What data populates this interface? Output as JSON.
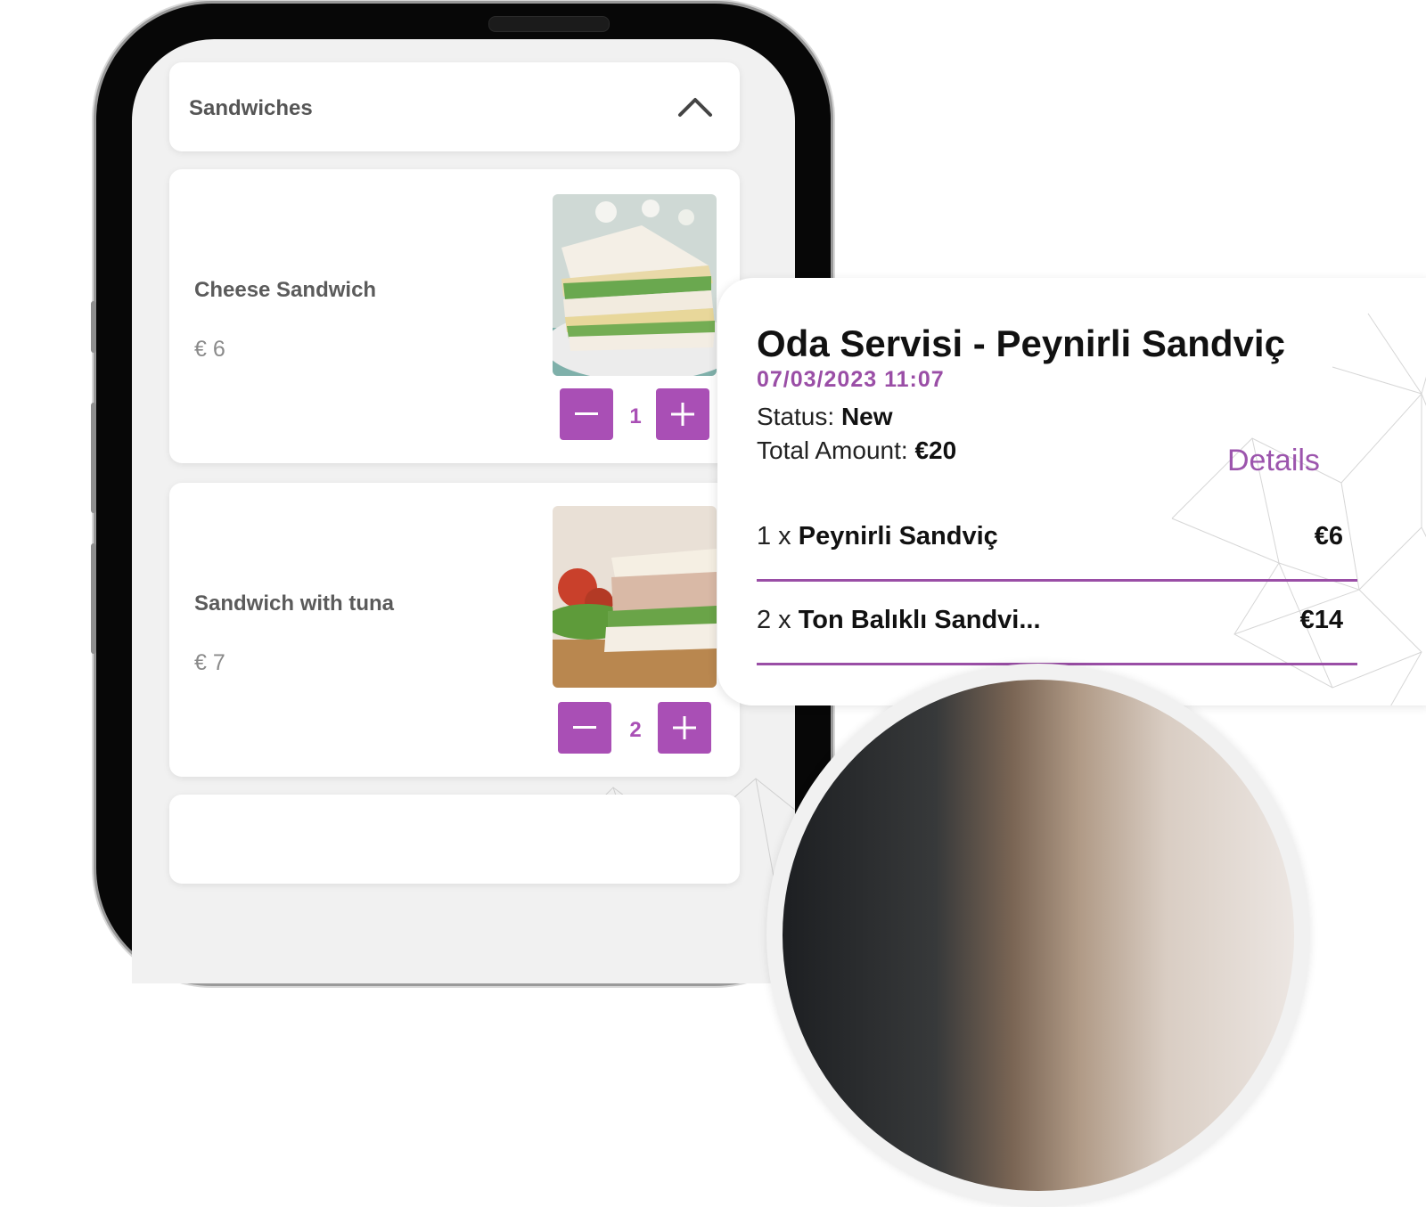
{
  "menu": {
    "category_title": "Sandwiches",
    "items": [
      {
        "name": "Cheese Sandwich",
        "price": "€ 6",
        "quantity": "1"
      },
      {
        "name": "Sandwich with tuna",
        "price": "€ 7",
        "quantity": "2"
      }
    ]
  },
  "order": {
    "title": "Oda Servisi - Peynirli Sandviç",
    "datetime": "07/03/2023 11:07",
    "status_label": "Status:",
    "status_value": "New",
    "total_label": "Total Amount:",
    "total_value": "€20",
    "details_label": "Details",
    "lines": [
      {
        "qty": "1 x",
        "name": "Peynirli Sandviç",
        "price": "€6"
      },
      {
        "qty": "2 x",
        "name": "Ton Balıklı Sandvi...",
        "price": "€14"
      }
    ]
  },
  "colors": {
    "accent": "#a94fb5",
    "accent_text": "#9a4ea6"
  },
  "icons": {
    "collapse": "chevron-up-icon",
    "decrement": "minus-icon",
    "increment": "plus-icon"
  }
}
